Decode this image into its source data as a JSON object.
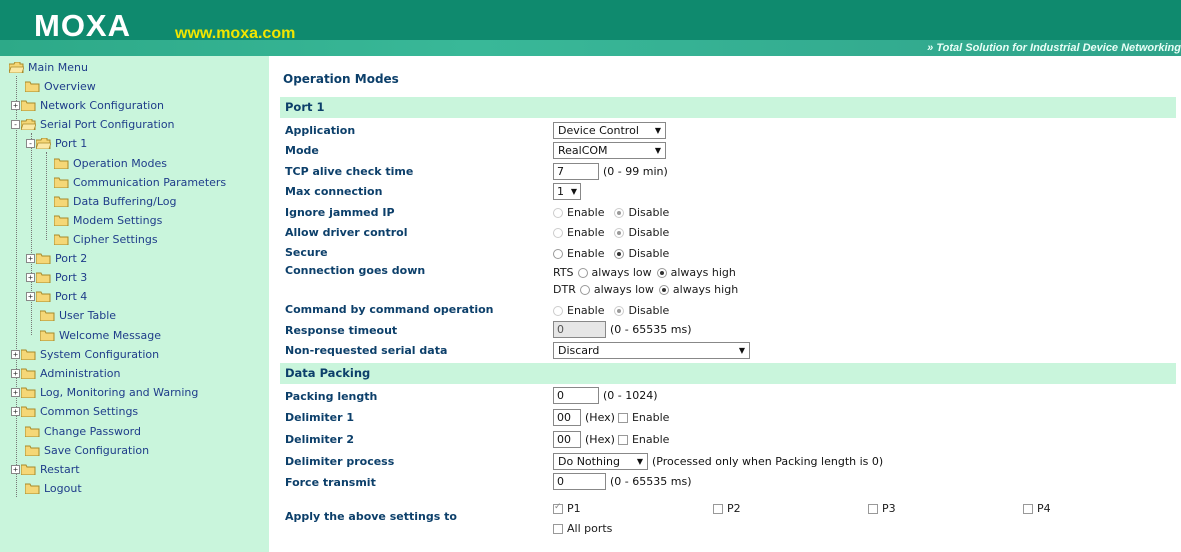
{
  "header": {
    "logo": "MOXA",
    "url": "www.moxa.com",
    "tagline": "» Total Solution for Industrial Device Networking"
  },
  "sidebar": {
    "items": [
      {
        "label": "Main Menu",
        "icon": "folder-open-icon"
      },
      {
        "label": "Overview",
        "icon": "folder-icon"
      },
      {
        "label": "Network Configuration",
        "icon": "folder-icon"
      },
      {
        "label": "Serial Port Configuration",
        "icon": "folder-open-icon"
      },
      {
        "label": "Port 1",
        "icon": "folder-open-icon"
      },
      {
        "label": "Operation Modes",
        "icon": "folder-icon"
      },
      {
        "label": "Communication Parameters",
        "icon": "folder-icon"
      },
      {
        "label": "Data Buffering/Log",
        "icon": "folder-icon"
      },
      {
        "label": "Modem Settings",
        "icon": "folder-icon"
      },
      {
        "label": "Cipher Settings",
        "icon": "folder-icon"
      },
      {
        "label": "Port 2",
        "icon": "folder-icon"
      },
      {
        "label": "Port 3",
        "icon": "folder-icon"
      },
      {
        "label": "Port 4",
        "icon": "folder-icon"
      },
      {
        "label": "User Table",
        "icon": "folder-icon"
      },
      {
        "label": "Welcome Message",
        "icon": "folder-icon"
      },
      {
        "label": "System Configuration",
        "icon": "folder-icon"
      },
      {
        "label": "Administration",
        "icon": "folder-icon"
      },
      {
        "label": "Log, Monitoring and Warning",
        "icon": "folder-icon"
      },
      {
        "label": "Common Settings",
        "icon": "folder-icon"
      },
      {
        "label": "Change Password",
        "icon": "folder-icon"
      },
      {
        "label": "Save Configuration",
        "icon": "folder-icon"
      },
      {
        "label": "Restart",
        "icon": "folder-icon"
      },
      {
        "label": "Logout",
        "icon": "folder-icon"
      }
    ]
  },
  "main": {
    "title": "Operation Modes",
    "port_section": "Port 1",
    "data_packing_section": "Data Packing",
    "labels": {
      "application": "Application",
      "mode": "Mode",
      "tcp_alive": "TCP alive check time",
      "max_connection": "Max connection",
      "ignore_jammed": "Ignore jammed IP",
      "allow_driver": "Allow driver control",
      "secure": "Secure",
      "conn_down": "Connection goes down",
      "cmd_by_cmd": "Command by command operation",
      "response_timeout": "Response timeout",
      "non_requested": "Non-requested serial data",
      "packing_length": "Packing length",
      "delimiter1": "Delimiter 1",
      "delimiter2": "Delimiter 2",
      "delimiter_process": "Delimiter process",
      "force_transmit": "Force transmit",
      "apply_to": "Apply the above settings to"
    },
    "values": {
      "application": "Device Control",
      "mode": "RealCOM",
      "tcp_alive": "7",
      "tcp_alive_hint": "(0 - 99 min)",
      "max_connection": "1",
      "response_timeout": "0",
      "response_timeout_hint": "(0 - 65535 ms)",
      "non_requested": "Discard",
      "packing_length": "0",
      "packing_length_hint": "(0 - 1024)",
      "delimiter1": "00",
      "delimiter2": "00",
      "hex_hint": "(Hex)",
      "delimiter_process": "Do Nothing",
      "delimiter_process_hint": "(Processed only when Packing length is 0)",
      "force_transmit": "0",
      "force_transmit_hint": "(0 - 65535 ms)"
    },
    "options": {
      "enable": "Enable",
      "disable": "Disable",
      "rts": "RTS",
      "dtr": "DTR",
      "always_low": "always low",
      "always_high": "always high",
      "p1": "P1",
      "p2": "P2",
      "p3": "P3",
      "p4": "P4",
      "all_ports": "All ports"
    }
  },
  "colors": {
    "header": "#0f8a6e",
    "url": "#f2e600",
    "sidebar_bg": "#c9f5dc",
    "label_text": "#0c3f6a",
    "link_text": "#1f3d8a"
  }
}
